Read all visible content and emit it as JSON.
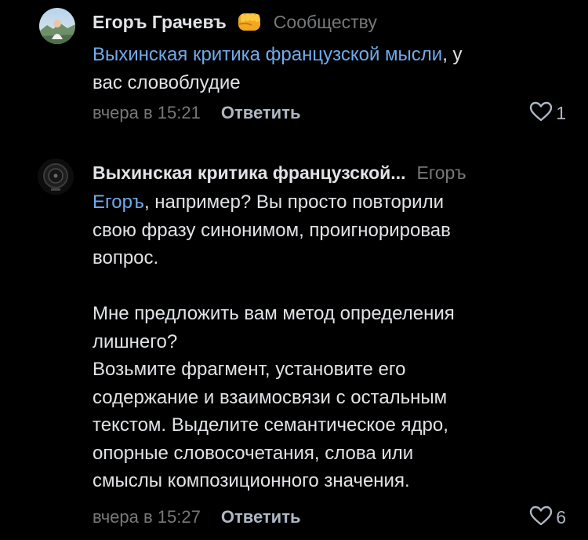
{
  "comments": [
    {
      "author": "Егоръ Грачевъ",
      "author_emoji": "fist-emoji",
      "reply_to": "Сообществу",
      "mention": "Выхинская критика французской мысли",
      "text_rest": ", у\nвас словоблудие",
      "time": "вчера в 15:21",
      "reply_label": "Ответить",
      "likes": "1"
    },
    {
      "author": "Выхинская критика французской...",
      "reply_to": "Егоръ",
      "mention": "Егоръ",
      "text_rest": ", например? Вы просто повторили\nсвою фразу синонимом, проигнорировав\nвопрос.\n\nМне предложить вам метод определения\nлишнего?\nВозьмите фрагмент, установите его\nсодержание и взаимосвязи с остальным\nтекстом. Выделите семантическое ядро,\nопорные словосочетания, слова или\nсмыслы композиционного значения.",
      "time": "вчера в 15:27",
      "reply_label": "Ответить",
      "likes": "6"
    }
  ],
  "colors": {
    "background": "#000000",
    "text": "#e1e3e6",
    "mention": "#71aaeb",
    "secondary": "#76787a",
    "action": "#aeb7c2"
  }
}
